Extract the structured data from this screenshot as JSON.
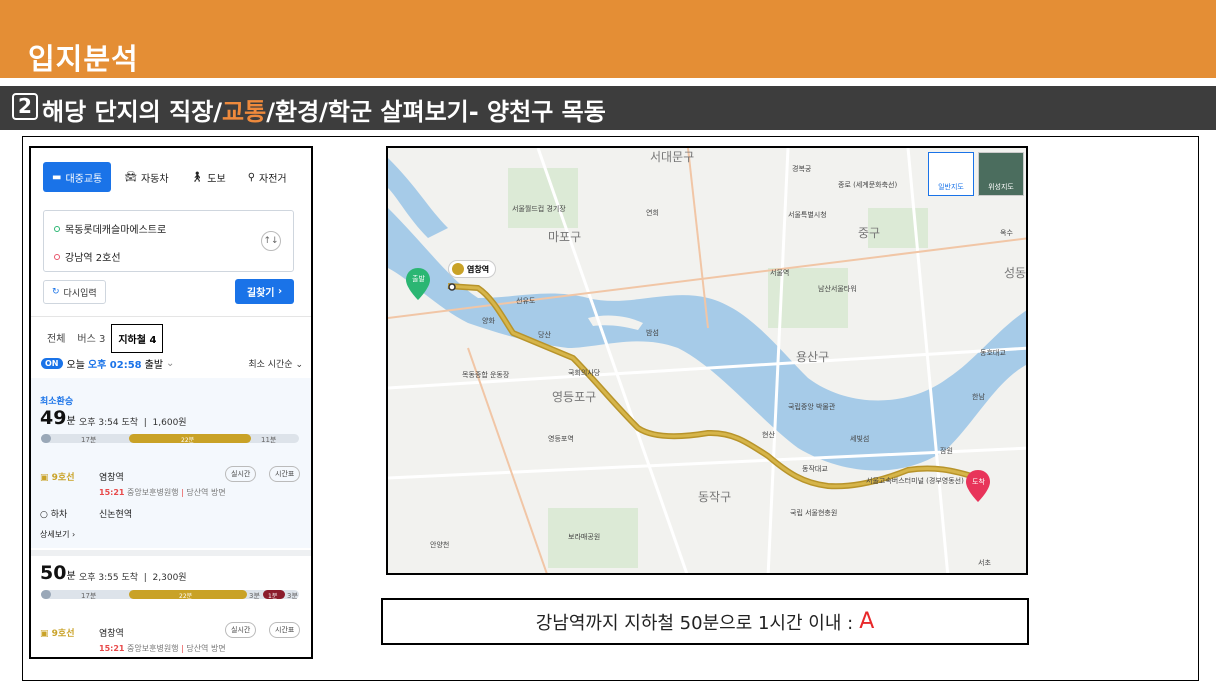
{
  "header": {
    "title": "입지분석"
  },
  "subheader": {
    "number": "2",
    "text_before": "해당 단지의 직장/",
    "highlight": "교통",
    "text_after": "/환경/학군 살펴보기- 양천구 목동"
  },
  "panel": {
    "modes": [
      {
        "label": "대중교통",
        "icon": "bus-icon"
      },
      {
        "label": "자동차",
        "icon": "car-icon"
      },
      {
        "label": "도보",
        "icon": "walk-icon"
      },
      {
        "label": "자전거",
        "icon": "bicycle-icon"
      }
    ],
    "origin": "목동롯데캐슬마에스트로",
    "destination": "강남역 2호선",
    "reset_label": "다시입력",
    "search_label": "길찾기",
    "tabs": [
      "전체",
      "버스 3",
      "지하철 4"
    ],
    "on_label": "ON",
    "today": "오늘",
    "depart_time": "오후 02:58",
    "depart_suffix": "출발",
    "sort_label": "최소 시간순",
    "route1": {
      "tag": "최소환승",
      "minutes": "49",
      "unit": "분",
      "arrive": "오후 3:54 도착",
      "fare": "1,600원",
      "walk1": "17분",
      "ride": "22분",
      "walk2": "11분",
      "line": "9호선",
      "board_station": "염창역",
      "realtime": "실시간",
      "timetable": "시간표",
      "train_time": "15:21",
      "train_desc": "중앙보훈병원행",
      "direction": "당산역 방면",
      "alight_label": "하차",
      "alight_station": "신논현역",
      "more": "상세보기"
    },
    "route2": {
      "minutes": "50",
      "unit": "분",
      "arrive": "오후 3:55 도착",
      "fare": "2,300원",
      "walk1": "17분",
      "ride": "22분",
      "walk2": "3분",
      "bus": "1분",
      "walk3": "3분",
      "line": "9호선",
      "board_station": "염창역",
      "realtime": "실시간",
      "timetable": "시간표",
      "train_time": "15:21",
      "train_desc": "중앙보훈병원행",
      "direction": "당산역 방면"
    }
  },
  "map": {
    "maptype_normal": "일반지도",
    "maptype_sat": "위성지도",
    "start_pin": "출발",
    "end_pin": "도착",
    "station_badge": "염창역",
    "districts": [
      "서대문구",
      "마포구",
      "중구",
      "용산구",
      "영등포구",
      "동작구",
      "성동"
    ],
    "places": [
      "경복궁",
      "종로 (세계문화축선)",
      "서울월드컵 경기장",
      "서울특별시청",
      "서울역",
      "남산서울타워",
      "국회의사당",
      "목동종합 운동장",
      "국립중앙 박물관",
      "국립 서울현충원",
      "서울고속버스터미널 (경부영동선)",
      "보라매공원",
      "선유도",
      "밤섬",
      "영등포역",
      "동작대교",
      "세빛섬",
      "한남",
      "잠원",
      "서초",
      "양화",
      "연희",
      "당산",
      "안양천",
      "현산",
      "옥수",
      "동호대교"
    ]
  },
  "caption": {
    "text": "강남역까지 지하철 50분으로 1시간 이내 :",
    "grade": "A"
  }
}
